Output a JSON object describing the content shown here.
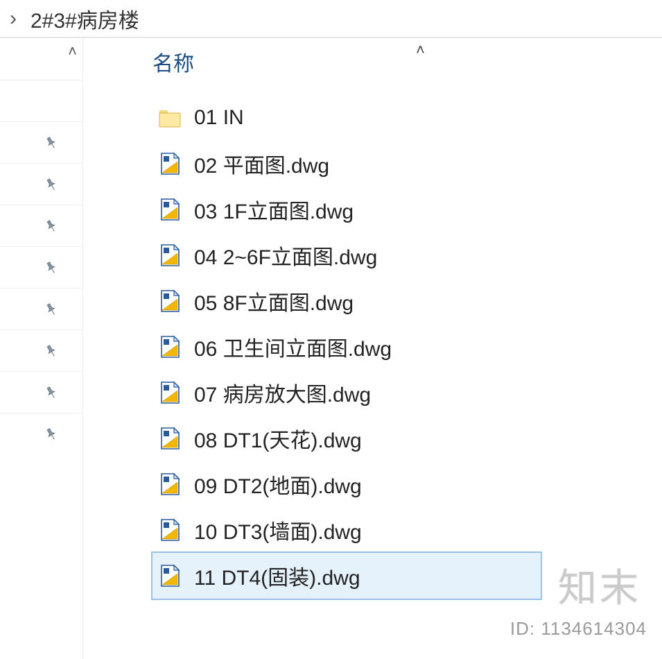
{
  "breadcrumb": {
    "chevron": "›",
    "location": "2#3#病房楼"
  },
  "columns": {
    "name_header": "名称",
    "sort_caret": "˄"
  },
  "nav": {
    "collapse_caret": "˄",
    "items": [
      {
        "pinned": false
      },
      {
        "pinned": false
      },
      {
        "pinned": true
      },
      {
        "pinned": true
      },
      {
        "pinned": true
      },
      {
        "pinned": true
      },
      {
        "pinned": true
      },
      {
        "pinned": true
      },
      {
        "pinned": true
      },
      {
        "pinned": true
      }
    ]
  },
  "files": [
    {
      "name": "01 IN",
      "type": "folder",
      "selected": false
    },
    {
      "name": "02 平面图.dwg",
      "type": "dwg",
      "selected": false
    },
    {
      "name": "03 1F立面图.dwg",
      "type": "dwg",
      "selected": false
    },
    {
      "name": "04 2~6F立面图.dwg",
      "type": "dwg",
      "selected": false
    },
    {
      "name": "05 8F立面图.dwg",
      "type": "dwg",
      "selected": false
    },
    {
      "name": "06 卫生间立面图.dwg",
      "type": "dwg",
      "selected": false
    },
    {
      "name": "07 病房放大图.dwg",
      "type": "dwg",
      "selected": false
    },
    {
      "name": "08 DT1(天花).dwg",
      "type": "dwg",
      "selected": false
    },
    {
      "name": "09 DT2(地面).dwg",
      "type": "dwg",
      "selected": false
    },
    {
      "name": "10 DT3(墙面).dwg",
      "type": "dwg",
      "selected": false
    },
    {
      "name": "11 DT4(固装).dwg",
      "type": "dwg",
      "selected": true
    }
  ],
  "watermark": {
    "logo": "知末",
    "id_label": "ID: 1134614304"
  }
}
